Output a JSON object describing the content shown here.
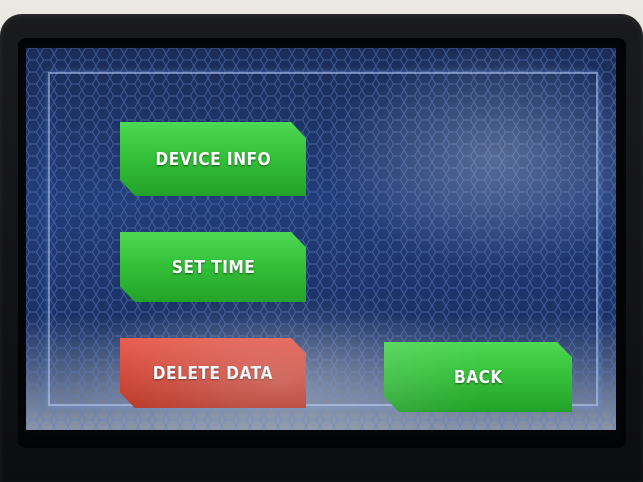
{
  "buttons": {
    "device_info": "DEVICE INFO",
    "set_time": "SET TIME",
    "delete_data": "DELETE DATA",
    "back": "BACK"
  },
  "colors": {
    "button_green": "#35c23a",
    "button_red": "#d4412f",
    "screen_background": "#223d78",
    "bezel": "#121315"
  }
}
